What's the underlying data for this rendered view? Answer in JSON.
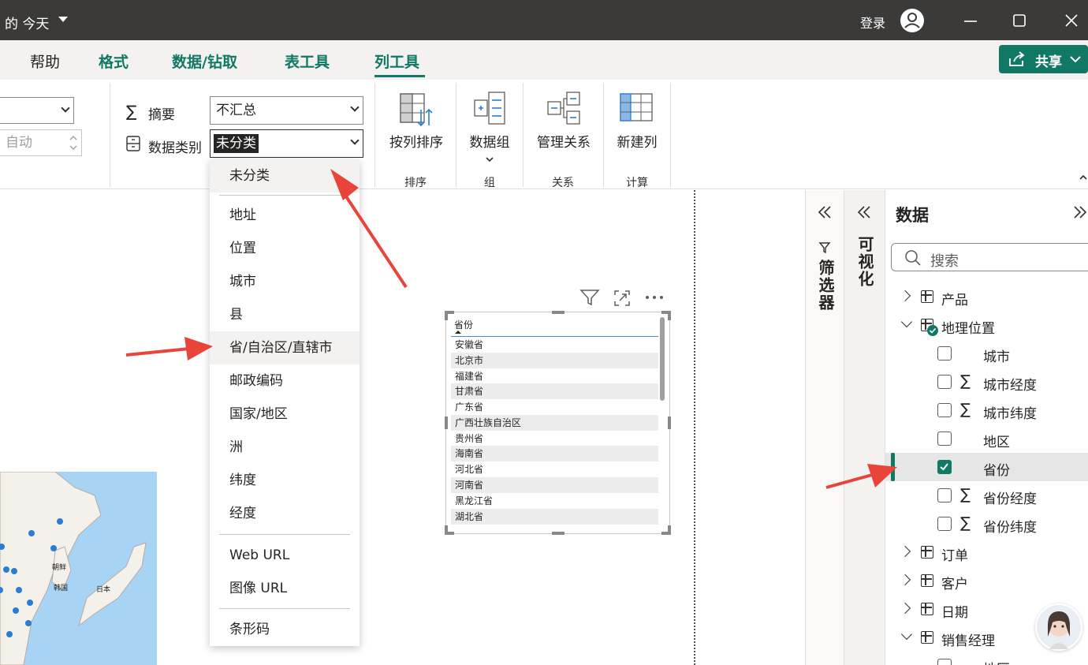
{
  "titlebar": {
    "doc_title": "的 今天",
    "login": "登录"
  },
  "tabs": [
    {
      "label": "帮助"
    },
    {
      "label": "格式"
    },
    {
      "label": "数据/钻取"
    },
    {
      "label": "表工具"
    },
    {
      "label": "列工具"
    }
  ],
  "share_label": "共享",
  "ribbon": {
    "left_spin_value": "自动",
    "summary_label": "摘要",
    "summary_value": "不汇总",
    "category_label": "数据类别",
    "category_value": "未分类",
    "sort_label": "按列排序",
    "sort_group": "排序",
    "datagroup_label": "数据组",
    "datagroup_group": "组",
    "relations_label": "管理关系",
    "relations_group": "关系",
    "newcol_label": "新建列",
    "newcol_group": "计算"
  },
  "menu": {
    "items": [
      "未分类",
      "地址",
      "位置",
      "城市",
      "县",
      "省/自治区/直辖市",
      "邮政编码",
      "国家/地区",
      "洲",
      "纬度",
      "经度",
      "Web URL",
      "图像 URL",
      "条形码"
    ],
    "selected": "未分类",
    "hovered": "省/自治区/直辖市"
  },
  "visual": {
    "header": "省份",
    "rows": [
      "安徽省",
      "北京市",
      "福建省",
      "甘肃省",
      "广东省",
      "广西壮族自治区",
      "贵州省",
      "海南省",
      "河北省",
      "河南省",
      "黑龙江省",
      "湖北省"
    ]
  },
  "map_labels": {
    "korea": "韩国",
    "japan": "日本",
    "chaoxian": "朝鲜"
  },
  "panes": {
    "filter_title": "筛选器",
    "viz_title": "可视化",
    "data_title": "数据",
    "search_placeholder": "搜索"
  },
  "data_tree": [
    {
      "label": "产品",
      "type": "table",
      "expanded": false
    },
    {
      "label": "地理位置",
      "type": "table",
      "expanded": true
    },
    {
      "label": "城市",
      "type": "field",
      "checked": false,
      "sigma": false
    },
    {
      "label": "城市经度",
      "type": "field",
      "checked": false,
      "sigma": true
    },
    {
      "label": "城市纬度",
      "type": "field",
      "checked": false,
      "sigma": true
    },
    {
      "label": "地区",
      "type": "field",
      "checked": false,
      "sigma": false
    },
    {
      "label": "省份",
      "type": "field",
      "checked": true,
      "sigma": false
    },
    {
      "label": "省份经度",
      "type": "field",
      "checked": false,
      "sigma": true
    },
    {
      "label": "省份纬度",
      "type": "field",
      "checked": false,
      "sigma": true
    },
    {
      "label": "订单",
      "type": "table",
      "expanded": false
    },
    {
      "label": "客户",
      "type": "table",
      "expanded": false
    },
    {
      "label": "日期",
      "type": "table",
      "expanded": false
    },
    {
      "label": "销售经理",
      "type": "table",
      "expanded": true
    },
    {
      "label": "地区",
      "type": "field",
      "checked": false,
      "sigma": false
    }
  ],
  "colors": {
    "accent": "#117865",
    "titlebar": "#3b3a39",
    "arrow": "#e8443a",
    "map_water": "#a7d3f5"
  }
}
